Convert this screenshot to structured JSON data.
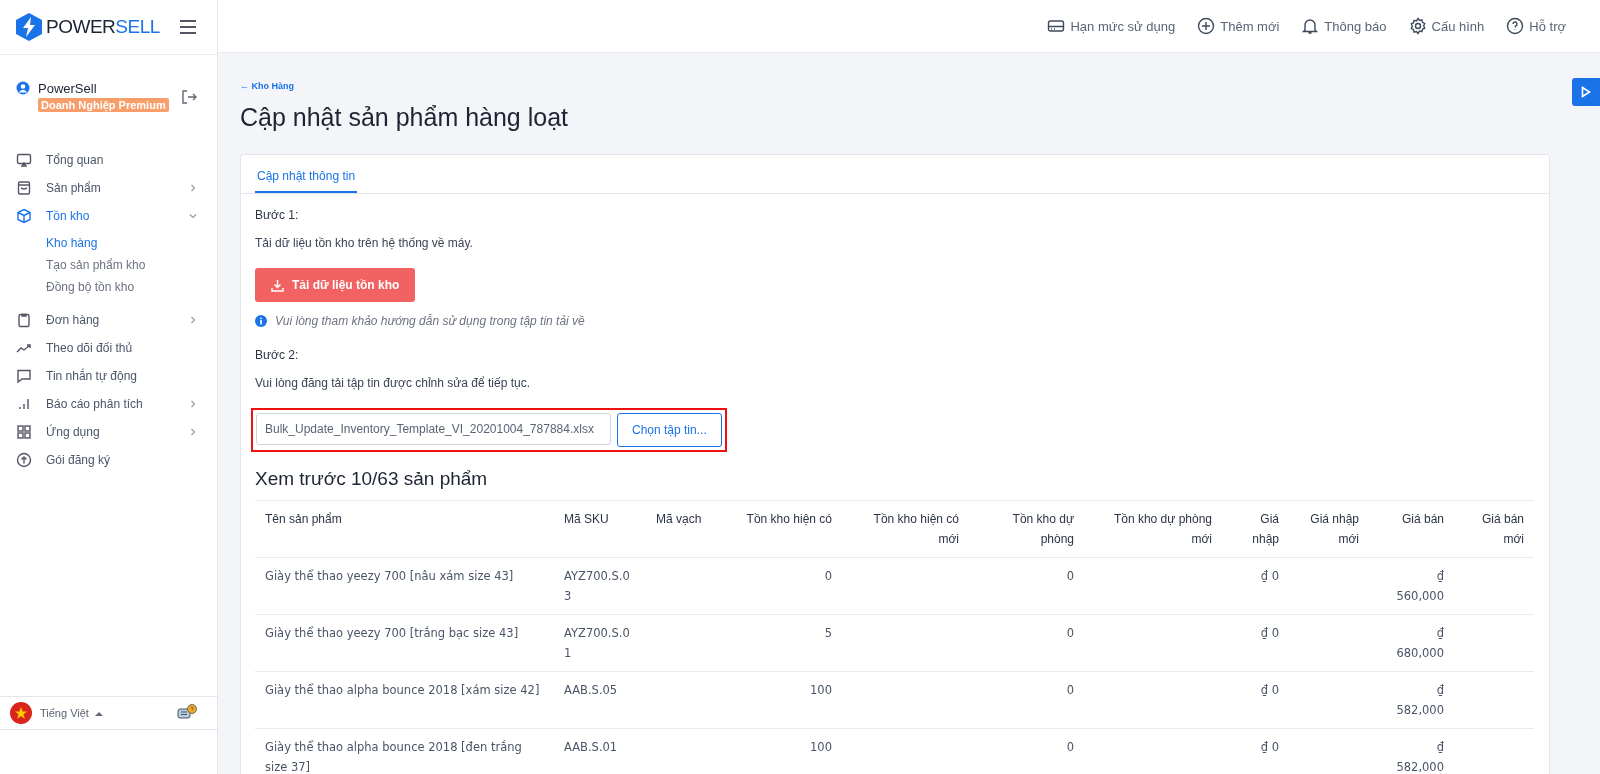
{
  "logo": {
    "part_1": "POWER",
    "part_2": "SELL"
  },
  "header_actions": [
    {
      "label": "Hạn mức sử dụng"
    },
    {
      "label": "Thêm mới"
    },
    {
      "label": "Thông báo"
    },
    {
      "label": "Cấu hình"
    },
    {
      "label": "Hỗ trợ"
    }
  ],
  "user": {
    "name": "PowerSell",
    "plan": "Doanh Nghiệp Premium"
  },
  "sidebar": {
    "items": [
      {
        "label": "Tổng quan",
        "selected": false
      },
      {
        "label": "Sản phẩm",
        "selected": false,
        "expanded": false
      },
      {
        "label": "Tồn kho",
        "selected": true,
        "expanded": true,
        "children": [
          {
            "label": "Kho hàng",
            "selected": true
          },
          {
            "label": "Tạo sản phẩm kho",
            "selected": false
          },
          {
            "label": "Đồng bộ tồn kho",
            "selected": false
          }
        ]
      },
      {
        "label": "Đơn hàng",
        "selected": false,
        "expanded": false
      },
      {
        "label": "Theo dõi đối thủ",
        "selected": false
      },
      {
        "label": "Tin nhắn tự động",
        "selected": false
      },
      {
        "label": "Báo cáo phân tích",
        "selected": false,
        "expanded": false
      },
      {
        "label": "Ứng dụng",
        "selected": false,
        "expanded": false
      },
      {
        "label": "Gói đăng ký",
        "selected": false
      }
    ]
  },
  "language": {
    "label": "Tiếng Việt"
  },
  "breadcrumb": "← Kho Hàng",
  "page_title": "Cập nhật sản phẩm hàng loạt",
  "tabs": [
    {
      "label": "Cập nhật thông tin",
      "selected": true
    }
  ],
  "step_1": {
    "title": "Bước 1:",
    "text": "Tải dữ liệu tồn kho trên hệ thống về máy.",
    "button": "Tải dữ liệu tồn kho",
    "note": "Vui lòng tham khảo hướng dẫn sử dụng trong tập tin tải về"
  },
  "step_2": {
    "title": "Bước 2:",
    "text": "Vui lòng đăng tải tập tin được chỉnh sửa để tiếp tục.",
    "file_value": "Bulk_Update_Inventory_Template_VI_20201004_787884.xlsx",
    "button": "Chọn tập tin..."
  },
  "preview": {
    "title": "Xem trước 10/63 sản phẩm",
    "columns": [
      "Tên sản phẩm",
      "Mã SKU",
      "Mã vạch",
      "Tồn kho hiện có",
      "Tồn kho hiện có mới",
      "Tồn kho dự phòng",
      "Tồn kho dự phòng mới",
      "Giá nhập",
      "Giá nhập mới",
      "Giá bán",
      "Giá bán mới"
    ],
    "rows": [
      [
        "Giày thể thao yeezy 700 [nâu xám size 43]",
        "AYZ700.S.03",
        null,
        "0",
        null,
        "0",
        null,
        "₫ 0",
        null,
        "₫ 560,000",
        null
      ],
      [
        "Giày thể thao yeezy 700 [trắng bạc size 43]",
        "AYZ700.S.01",
        null,
        "5",
        null,
        "0",
        null,
        "₫ 0",
        null,
        "₫ 680,000",
        null
      ],
      [
        "Giày thể thao alpha bounce 2018 [xám size 42]",
        "AAB.S.05",
        null,
        "100",
        null,
        "0",
        null,
        "₫ 0",
        null,
        "₫ 582,000",
        null
      ],
      [
        "Giày thể thao alpha bounce 2018 [đen trắng size 37]",
        "AAB.S.01",
        null,
        "100",
        null,
        "0",
        null,
        "₫ 0",
        null,
        "₫ 582,000",
        null
      ]
    ]
  }
}
